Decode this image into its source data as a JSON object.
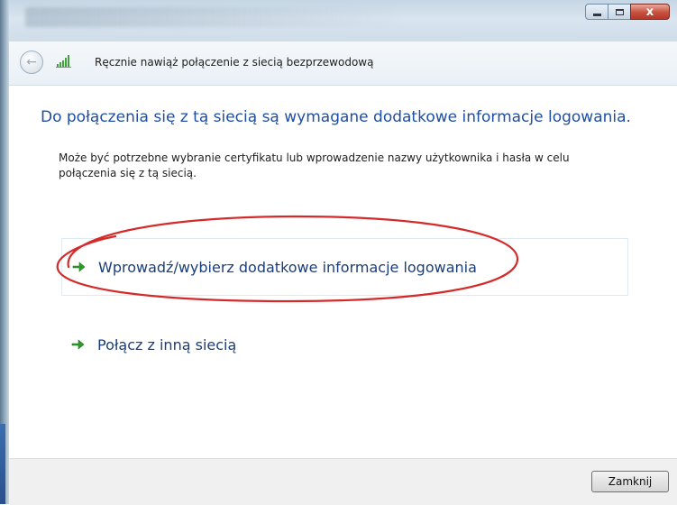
{
  "window": {
    "title": "Ręcznie nawiąż połączenie z siecią bezprzewodową",
    "close_glyph": "x"
  },
  "nav": {
    "back_icon": "back-arrow-icon",
    "network_icon": "wireless-signal-icon"
  },
  "main": {
    "heading": "Do połączenia się z tą siecią są wymagane dodatkowe informacje logowania.",
    "description": "Może być potrzebne wybranie certyfikatu lub wprowadzenie nazwy użytkownika i hasła w celu połączenia się z tą siecią.",
    "options": [
      {
        "label": "Wprowadź/wybierz dodatkowe informacje logowania",
        "icon": "green-arrow-icon"
      },
      {
        "label": "Połącz z inną siecią",
        "icon": "green-arrow-icon"
      }
    ]
  },
  "footer": {
    "close_label": "Zamknij"
  },
  "colors": {
    "heading": "#1f4ea3",
    "link": "#1a3e7a",
    "arrow": "#2e9a2e",
    "annotation": "#d42a2a"
  }
}
